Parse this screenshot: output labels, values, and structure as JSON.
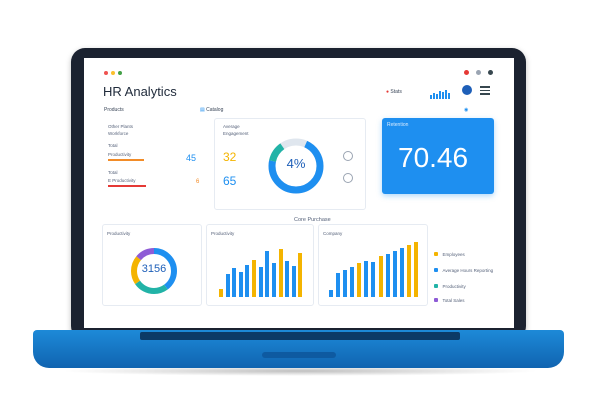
{
  "header": {
    "title": "HR Analytics",
    "link_text": "Stats",
    "filter_text": "Catalog"
  },
  "colors": {
    "accent": "#1e8ff0",
    "amber": "#f4b400",
    "teal": "#22b3a7",
    "orange": "#f28c28",
    "purple": "#8e5bd6"
  },
  "left_panel": {
    "title": "Products",
    "rows": [
      {
        "label": "Other Plants",
        "value": ""
      },
      {
        "label": "Workforce",
        "value": ""
      },
      {
        "label": "Total",
        "value": "45"
      },
      {
        "label": "Productivity",
        "value": ""
      },
      {
        "label": "Total",
        "value": ""
      },
      {
        "label": "E Productivity",
        "value": "6"
      }
    ]
  },
  "metric_panel": {
    "title": "Average",
    "subtitle": "Engagement",
    "value_1": "32",
    "value_2": "65",
    "donut_value": "4%"
  },
  "kpi_card": {
    "label": "Retention",
    "value": "70.46"
  },
  "section_title": "Core Purchase",
  "panels": {
    "left": {
      "title": "Productivity",
      "donut_value": "3156"
    },
    "mid": {
      "title": "Productivity"
    },
    "right": {
      "title": "Company"
    }
  },
  "legend": [
    {
      "label": "Employees",
      "color": "#f4b400"
    },
    {
      "label": "Average Hours Reporting",
      "color": "#1e8ff0"
    },
    {
      "label": "Productivity",
      "color": "#22b3a7"
    },
    {
      "label": "Total Sales",
      "color": "#8e5bd6"
    }
  ]
}
